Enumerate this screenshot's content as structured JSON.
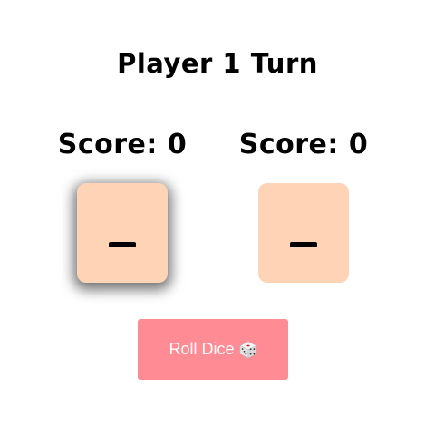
{
  "game": {
    "turn_title": "Player 1 Turn",
    "active_player": 1
  },
  "players": [
    {
      "score_label": "Score: 0",
      "score": 0,
      "die_face": "–"
    },
    {
      "score_label": "Score: 0",
      "score": 0,
      "die_face": "–"
    }
  ],
  "controls": {
    "roll_label": "Roll Dice",
    "roll_icon": "dice-icon"
  },
  "colors": {
    "die_background": "#ffd3b6",
    "button_background": "#ff8b94",
    "button_text": "#ffffff",
    "text": "#000000"
  }
}
